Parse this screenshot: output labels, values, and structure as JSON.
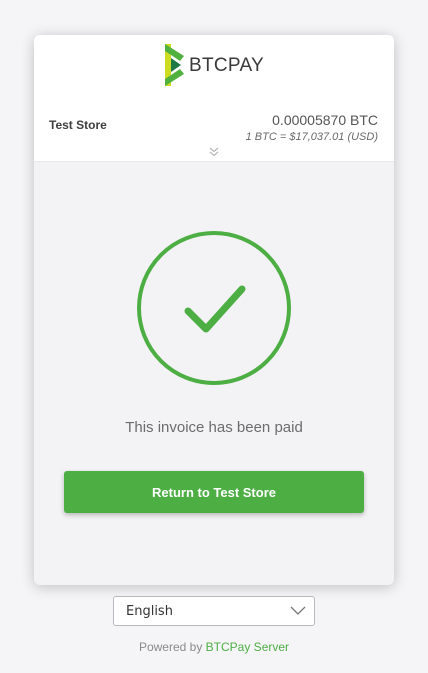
{
  "header": {
    "logo_text": "BTCPAY",
    "store_name": "Test Store",
    "amount": "0.00005870 BTC",
    "rate": "1 BTC = $17,037.01 (USD)"
  },
  "status": {
    "message": "This invoice has been paid",
    "color": "#4dae44"
  },
  "actions": {
    "return_label": "Return to Test Store"
  },
  "language": {
    "selected": "English"
  },
  "footer": {
    "powered_prefix": "Powered by",
    "powered_link": "BTCPay Server"
  },
  "colors": {
    "brand_green": "#4dae44",
    "logo_green_light": "#cedc21",
    "logo_green_dark": "#51b13e"
  }
}
